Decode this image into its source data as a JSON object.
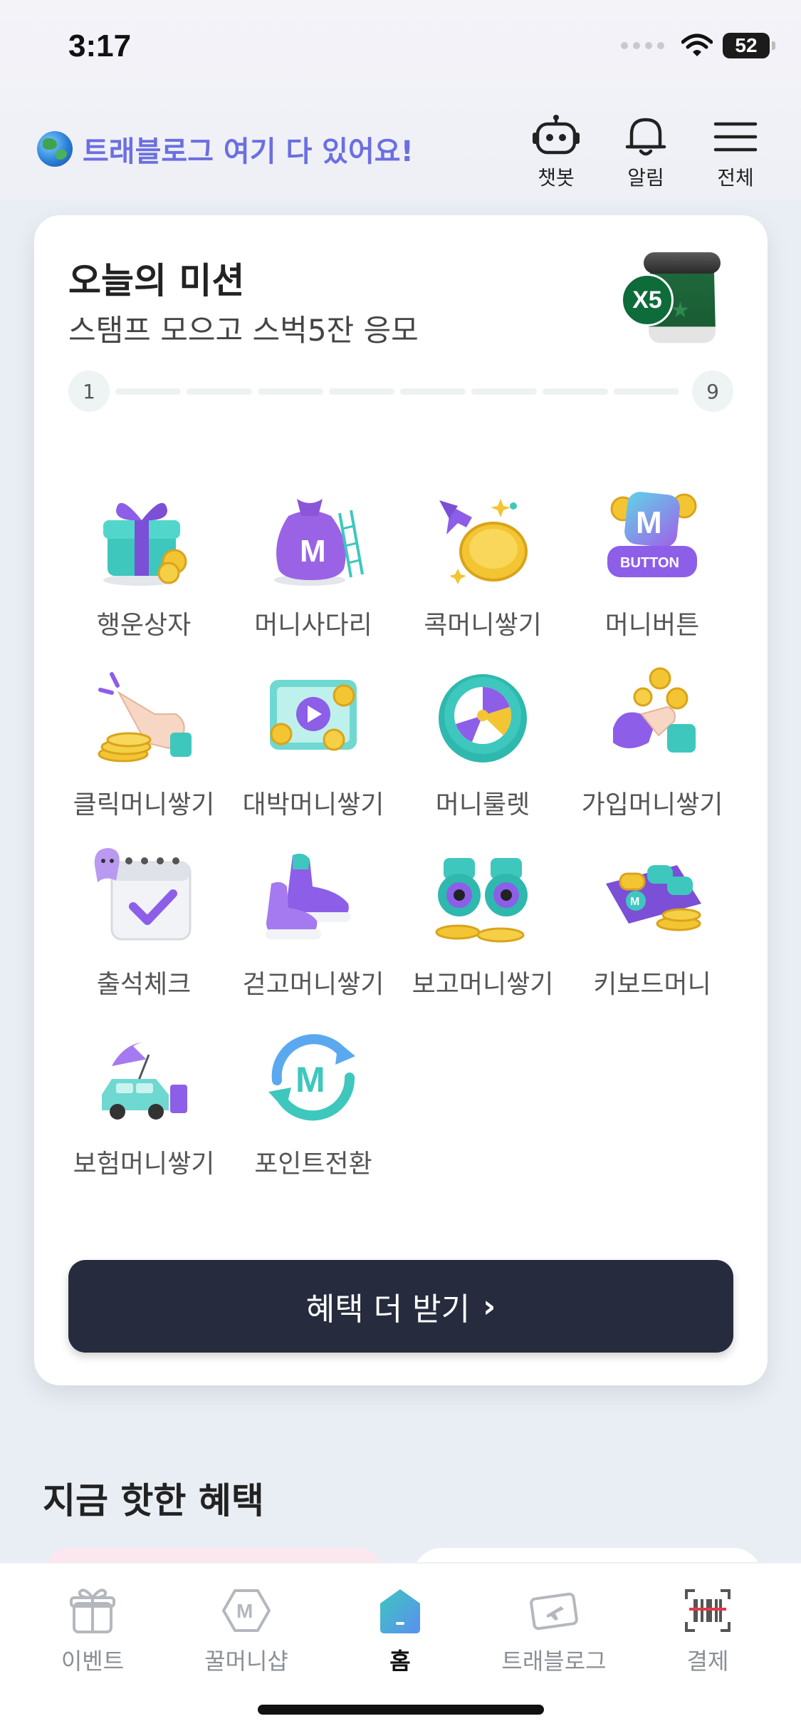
{
  "status_bar": {
    "time": "3:17",
    "battery": "52"
  },
  "header": {
    "promo_text": "트래블로그 여기 다 있어요!",
    "actions": [
      {
        "label": "챗봇",
        "icon": "robot-icon"
      },
      {
        "label": "알림",
        "icon": "bell-icon"
      },
      {
        "label": "전체",
        "icon": "menu-icon"
      }
    ]
  },
  "mission": {
    "title": "오늘의 미션",
    "subtitle": "스탬프 모으고 스벅5잔 응모",
    "badge": "X5",
    "progress": {
      "start": "1",
      "end": "9",
      "completed": 0
    },
    "items": [
      {
        "label": "행운상자",
        "icon": "gift-box-icon"
      },
      {
        "label": "머니사다리",
        "icon": "money-bag-ladder-icon"
      },
      {
        "label": "콕머니쌓기",
        "icon": "coin-star-icon"
      },
      {
        "label": "머니버튼",
        "icon": "m-button-icon"
      },
      {
        "label": "클릭머니쌓기",
        "icon": "click-hand-icon"
      },
      {
        "label": "대박머니쌓기",
        "icon": "video-coins-icon"
      },
      {
        "label": "머니룰렛",
        "icon": "roulette-icon"
      },
      {
        "label": "가입머니쌓기",
        "icon": "signup-hand-icon"
      },
      {
        "label": "출석체크",
        "icon": "calendar-check-icon"
      },
      {
        "label": "걷고머니쌓기",
        "icon": "sneakers-icon"
      },
      {
        "label": "보고머니쌓기",
        "icon": "binoculars-icon"
      },
      {
        "label": "키보드머니",
        "icon": "keyboard-icon"
      },
      {
        "label": "보험머니쌓기",
        "icon": "car-umbrella-icon"
      },
      {
        "label": "포인트전환",
        "icon": "point-exchange-icon"
      }
    ],
    "more_button": "혜택 더 받기"
  },
  "section": {
    "title": "지금 핫한 혜택"
  },
  "bottom_nav": [
    {
      "label": "이벤트",
      "icon": "gift-icon"
    },
    {
      "label": "꿀머니샵",
      "icon": "m-hexagon-icon"
    },
    {
      "label": "홈",
      "icon": "home-icon",
      "active": true
    },
    {
      "label": "트래블로그",
      "icon": "travel-card-icon"
    },
    {
      "label": "결제",
      "icon": "barcode-scan-icon"
    }
  ],
  "colors": {
    "accent": "#6b6fe0",
    "button": "#262c3d",
    "background": "#e9eef4"
  }
}
